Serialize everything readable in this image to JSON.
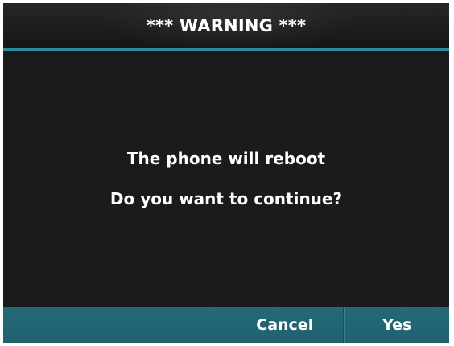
{
  "dialog": {
    "title": "*** WARNING ***",
    "message_lines": [
      "The phone will reboot",
      "Do you want to continue?"
    ]
  },
  "softkeys": [
    {
      "label": ""
    },
    {
      "label": ""
    },
    {
      "label": "Cancel"
    },
    {
      "label": "Yes"
    }
  ],
  "colors": {
    "screen_background": "#1b1b1b",
    "title_accent": "#2e8a9c",
    "softkey_bar": "#246a77",
    "text": "#ffffff"
  }
}
